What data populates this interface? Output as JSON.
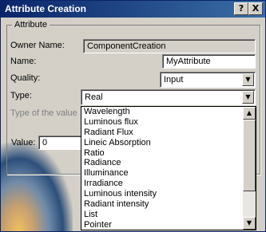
{
  "dialog": {
    "title": "Attribute Creation",
    "help_button": "?",
    "close_button": "X"
  },
  "attribute": {
    "group_label": "Attribute",
    "owner_label": "Owner Name:",
    "owner_value": "ComponentCreation",
    "name_label": "Name:",
    "name_value": "MyAttribute",
    "quality_label": "Quality:",
    "quality_value": "Input",
    "type_label": "Type:",
    "type_value": "Real",
    "type_of_value_label": "Type of the value",
    "value_label": "Value:",
    "value_value": "0"
  },
  "type_dropdown": {
    "items": [
      "Wavelength",
      "Luminous flux",
      "Radiant Flux",
      "Lineic Absorption",
      "Ratio",
      "Radiance",
      "Illuminance",
      "Irradiance",
      "Luminous intensity",
      "Radiant intensity",
      "List",
      "Pointer"
    ]
  },
  "icons": {
    "dropdown_arrow": "chevron-down-icon",
    "scroll_up": "scroll-up-icon",
    "scroll_down": "scroll-down-icon"
  },
  "colors": {
    "titlebar_start": "#0a246a",
    "titlebar_end": "#3a6ea5",
    "dialog_face": "#d4d0c8"
  }
}
